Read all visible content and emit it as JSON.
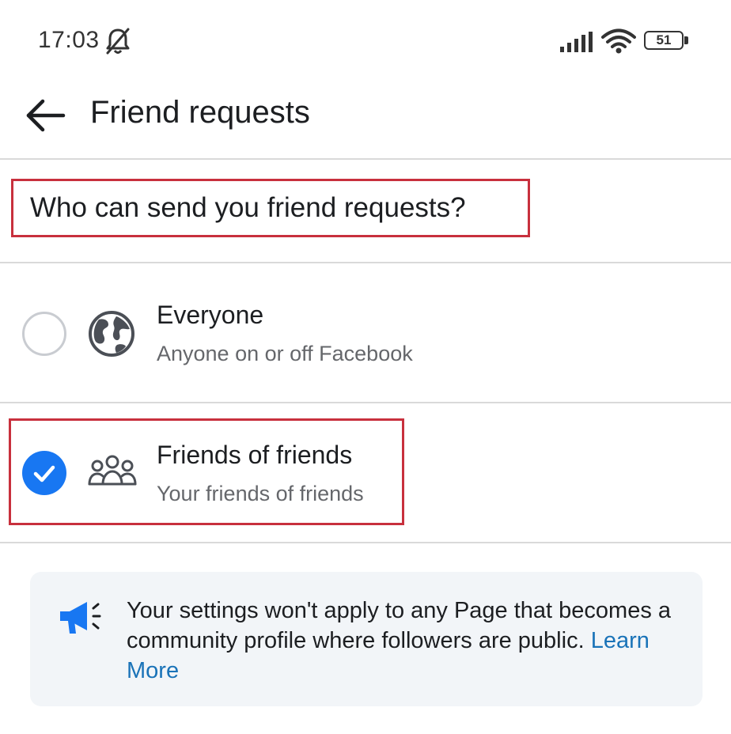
{
  "status_bar": {
    "time": "17:03",
    "battery": "51"
  },
  "header": {
    "title": "Friend requests"
  },
  "question": "Who can send you friend requests?",
  "options": [
    {
      "title": "Everyone",
      "subtitle": "Anyone on or off Facebook",
      "selected": false,
      "icon": "globe-icon"
    },
    {
      "title": "Friends of friends",
      "subtitle": "Your friends of friends",
      "selected": true,
      "icon": "people-icon"
    }
  ],
  "info": {
    "text": "Your settings won't apply to any Page that becomes a community profile where followers are public.",
    "link": "Learn More"
  },
  "colors": {
    "accent": "#1877f2",
    "highlight": "#c8303d",
    "link": "#1a73b8"
  }
}
